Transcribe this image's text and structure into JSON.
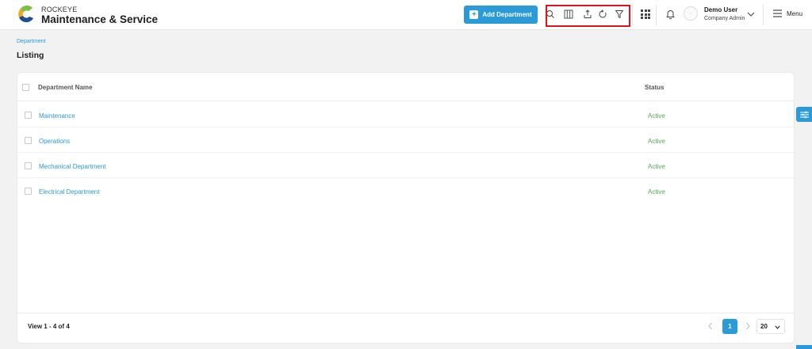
{
  "header": {
    "brand_small": "ROCKEYE",
    "brand_big": "Maintenance & Service",
    "add_button_label": "Add Department",
    "user": {
      "name": "Demo User",
      "role": "Company Admin",
      "avatar_text": "~"
    },
    "menu_label": "Menu",
    "toolbar_icons": [
      "search-icon",
      "columns-icon",
      "export-icon",
      "refresh-icon",
      "filter-icon"
    ]
  },
  "breadcrumb": "Department",
  "page_title": "Listing",
  "table": {
    "columns": [
      "Department Name",
      "Status"
    ],
    "rows": [
      {
        "name": "Maintenance",
        "status": "Active"
      },
      {
        "name": "Operations",
        "status": "Active"
      },
      {
        "name": "Mechanical Department",
        "status": "Active"
      },
      {
        "name": "Electrical Department",
        "status": "Active"
      }
    ]
  },
  "pagination": {
    "view_text": "View 1 - 4 of 4",
    "current_page": "1",
    "page_size": "20"
  },
  "colors": {
    "accent": "#2a9bd8",
    "active_status": "#4caf50",
    "highlight": "#e0141e"
  }
}
